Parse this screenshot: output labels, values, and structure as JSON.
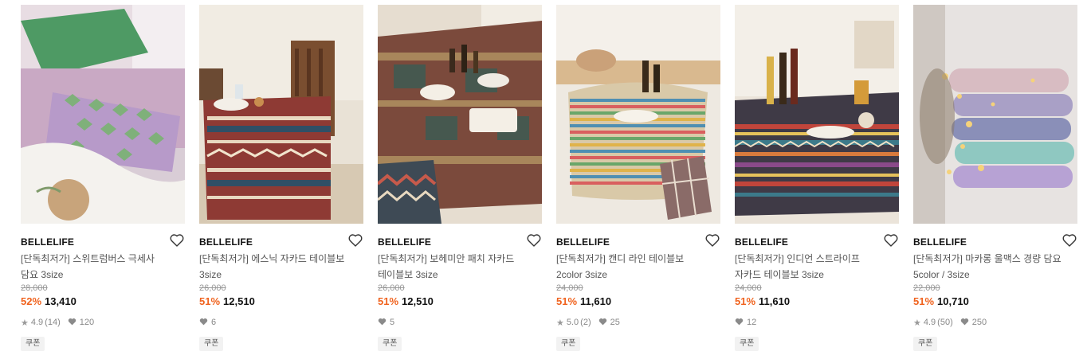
{
  "products": [
    {
      "brand": "BELLELIFE",
      "title_line1": "[단독최저가] 스위트럼버스 극세사",
      "title_line2": "담요 3size",
      "original_price": "28,000",
      "discount": "52%",
      "price": "13,410",
      "rating": "4.9",
      "reviews": "(14)",
      "likes": "120",
      "coupon": "쿠폰"
    },
    {
      "brand": "BELLELIFE",
      "title_line1": "[단독최저가] 에스닉 자카드 테이블보",
      "title_line2": "3size",
      "original_price": "26,000",
      "discount": "51%",
      "price": "12,510",
      "rating": "",
      "reviews": "",
      "likes": "6",
      "coupon": "쿠폰"
    },
    {
      "brand": "BELLELIFE",
      "title_line1": "[단독최저가] 보헤미안 패치 자카드",
      "title_line2": "테이블보 3size",
      "original_price": "26,000",
      "discount": "51%",
      "price": "12,510",
      "rating": "",
      "reviews": "",
      "likes": "5",
      "coupon": "쿠폰"
    },
    {
      "brand": "BELLELIFE",
      "title_line1": "[단독최저가] 캔디 라인 테이블보",
      "title_line2": "2color 3size",
      "original_price": "24,000",
      "discount": "51%",
      "price": "11,610",
      "rating": "5.0",
      "reviews": "(2)",
      "likes": "25",
      "coupon": "쿠폰"
    },
    {
      "brand": "BELLELIFE",
      "title_line1": "[단독최저가] 인디언 스트라이프",
      "title_line2": "자카드 테이블보 3size",
      "original_price": "24,000",
      "discount": "51%",
      "price": "11,610",
      "rating": "",
      "reviews": "",
      "likes": "12",
      "coupon": "쿠폰"
    },
    {
      "brand": "BELLELIFE",
      "title_line1": "[단독최저가] 마카롱 울맥스 경량 담요",
      "title_line2": "5color / 3size",
      "original_price": "22,000",
      "discount": "51%",
      "price": "10,710",
      "rating": "4.9",
      "reviews": "(50)",
      "likes": "250",
      "coupon": "쿠폰"
    }
  ],
  "colors": {
    "discount": "#f0621d",
    "price": "#111111",
    "muted": "#999999",
    "coupon_bg": "#f2f2f2"
  }
}
